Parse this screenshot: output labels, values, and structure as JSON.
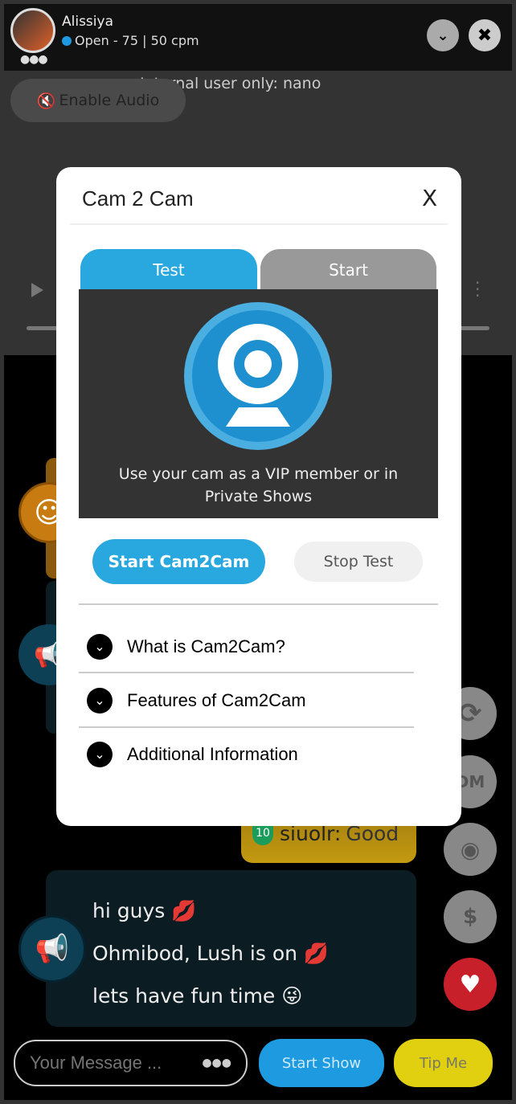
{
  "header": {
    "name": "Alissiya",
    "status": "Open - 75 | 50 cpm",
    "status_color": "#1e9be0"
  },
  "video": {
    "internal_notice": "Internal user only: nano",
    "enable_audio": "Enable Audio"
  },
  "chat": {
    "messages": [
      {
        "user": "siuolr:",
        "text": "Good",
        "level": "10"
      },
      {
        "lines": [
          "hi guys",
          "Ohmibod, Lush is on",
          "lets have fun time"
        ]
      }
    ]
  },
  "side_buttons": [
    "refresh-icon",
    "dm-icon",
    "webcam-icon",
    "dollar-icon",
    "heart-icon"
  ],
  "side_labels": {
    "dm": "DM",
    "dollar": "$"
  },
  "footer": {
    "placeholder": "Your Message ...",
    "start_show": "Start Show",
    "tip_me": "Tip Me"
  },
  "modal": {
    "title": "Cam 2 Cam",
    "close": "X",
    "tabs": [
      {
        "label": "Test",
        "active": true
      },
      {
        "label": "Start",
        "active": false
      }
    ],
    "description": "Use your cam as a VIP member or in Private Shows",
    "start_button": "Start Cam2Cam",
    "stop_button": "Stop Test",
    "accordion": [
      "What is Cam2Cam?",
      "Features of Cam2Cam",
      "Additional Information"
    ],
    "accent": "#29a8e0"
  }
}
